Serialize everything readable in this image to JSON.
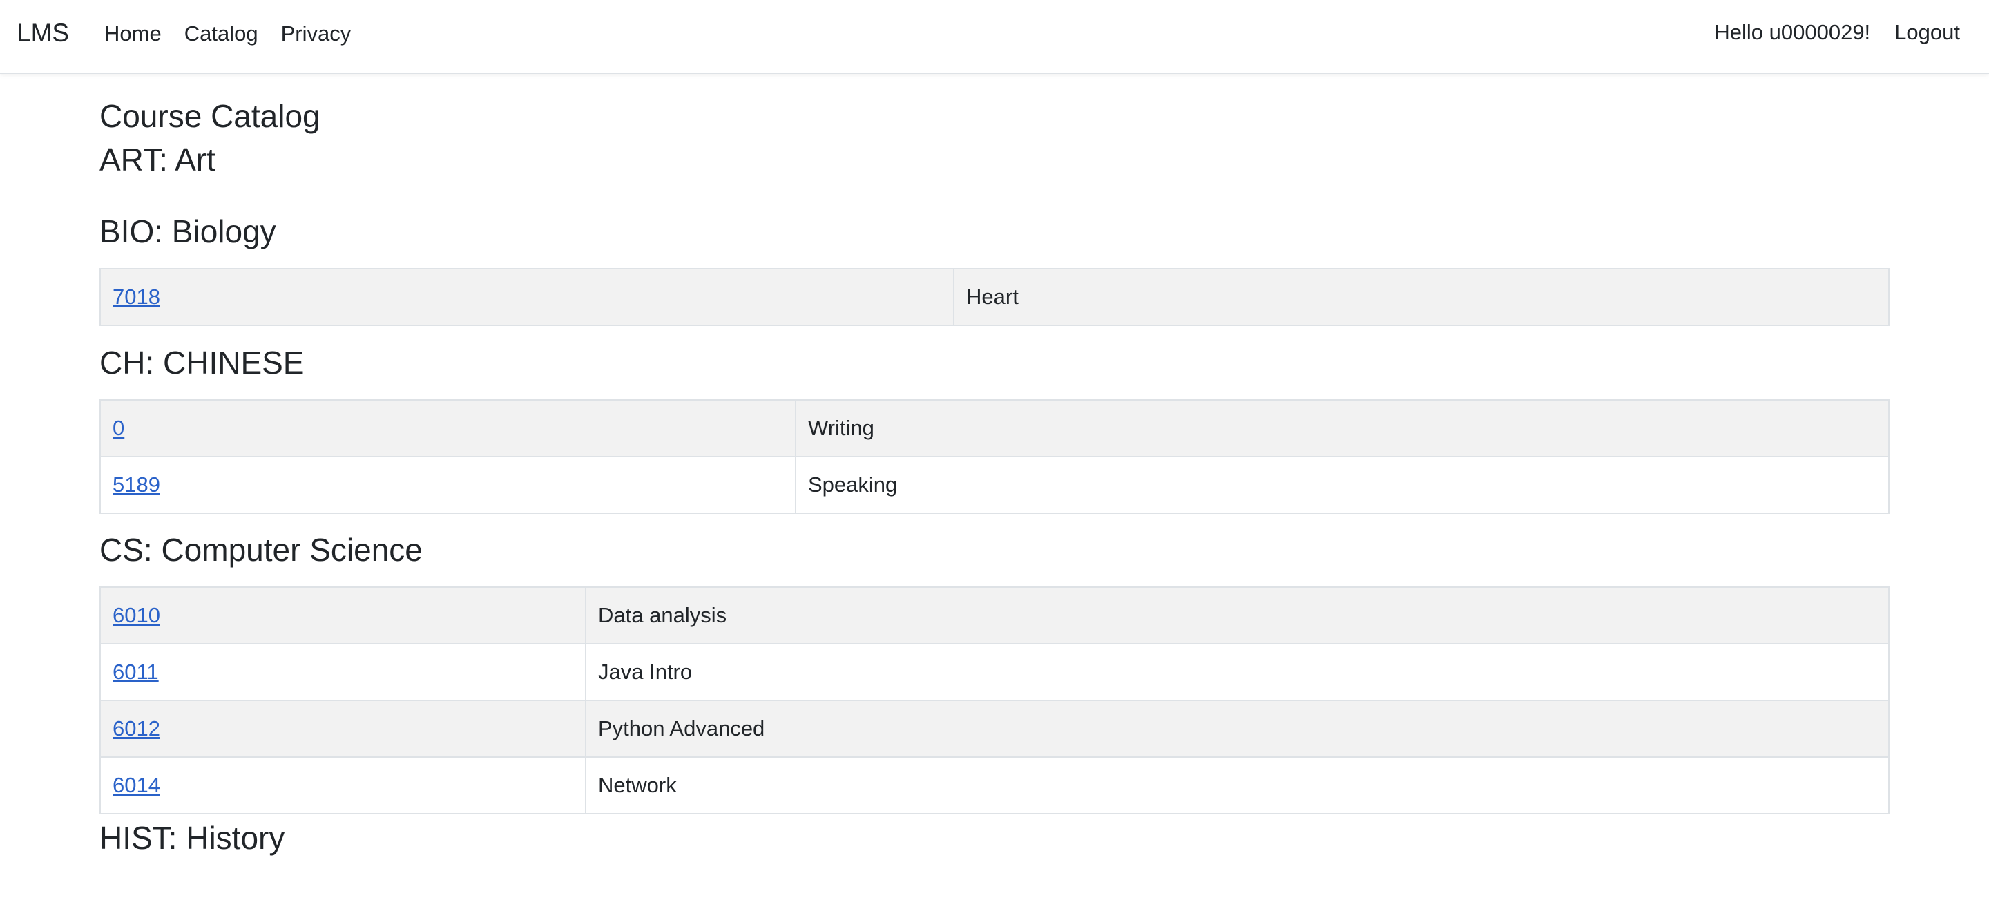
{
  "nav": {
    "brand": "LMS",
    "links": [
      "Home",
      "Catalog",
      "Privacy"
    ],
    "greeting": "Hello u0000029!",
    "logout": "Logout"
  },
  "page_title": "Course Catalog",
  "departments": [
    {
      "title": "ART: Art",
      "courses": []
    },
    {
      "title": "BIO: Biology",
      "courses": [
        {
          "number": "7018",
          "name": "Heart"
        }
      ]
    },
    {
      "title": "CH: CHINESE",
      "courses": [
        {
          "number": "0",
          "name": "Writing"
        },
        {
          "number": "5189",
          "name": "Speaking"
        }
      ]
    },
    {
      "title": "CS: Computer Science",
      "courses": [
        {
          "number": "6010",
          "name": "Data analysis"
        },
        {
          "number": "6011",
          "name": "Java Intro"
        },
        {
          "number": "6012",
          "name": "Python Advanced"
        },
        {
          "number": "6014",
          "name": "Network"
        }
      ]
    },
    {
      "title": "HIST: History",
      "courses": []
    }
  ]
}
